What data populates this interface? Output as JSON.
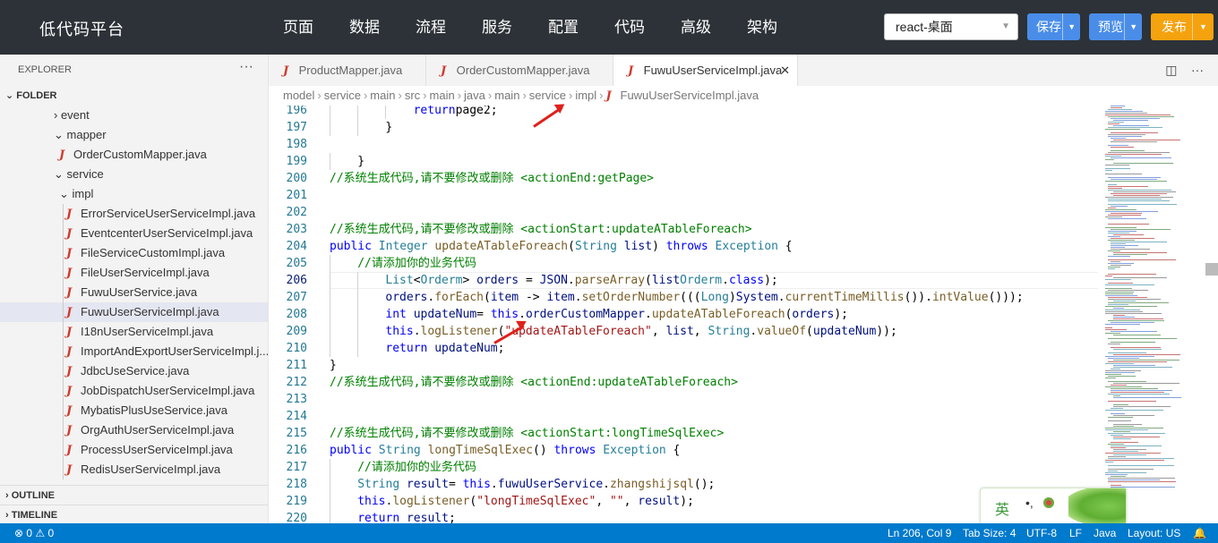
{
  "app": {
    "title": "低代码平台",
    "nav": [
      "页面",
      "数据",
      "流程",
      "服务",
      "配置",
      "代码",
      "高级",
      "架构"
    ],
    "env_select": "react-桌面",
    "buttons": {
      "save": "保存",
      "preview": "预览",
      "publish": "发布"
    },
    "colors": {
      "topbar": "#2d3238",
      "save": "#4a8de8",
      "publish": "#f5a20f",
      "status": "#007acc"
    }
  },
  "sidebar": {
    "title": "EXPLORER",
    "more": "···",
    "folder": "FOLDER",
    "items": [
      {
        "label": "event",
        "kind": "folder",
        "open": false,
        "indent": 1
      },
      {
        "label": "mapper",
        "kind": "folder",
        "open": true,
        "indent": 1
      },
      {
        "label": "OrderCustomMapper.java",
        "kind": "java",
        "indent": 2
      },
      {
        "label": "service",
        "kind": "folder",
        "open": true,
        "indent": 1
      },
      {
        "label": "impl",
        "kind": "folder",
        "open": true,
        "indent": 2
      },
      {
        "label": "ErrorServiceUserServiceImpl.java",
        "kind": "java",
        "indent": 3
      },
      {
        "label": "EventcenterUserServiceImpl.java",
        "kind": "java",
        "indent": 3
      },
      {
        "label": "FileServiceCustomImpl.java",
        "kind": "java",
        "indent": 3
      },
      {
        "label": "FileUserServiceImpl.java",
        "kind": "java",
        "indent": 3
      },
      {
        "label": "FuwuUserService.java",
        "kind": "java",
        "indent": 3
      },
      {
        "label": "FuwuUserServiceImpl.java",
        "kind": "java",
        "indent": 3,
        "selected": true
      },
      {
        "label": "I18nUserServiceImpl.java",
        "kind": "java",
        "indent": 3
      },
      {
        "label": "ImportAndExportUserServiceImpl.j...",
        "kind": "java",
        "indent": 3
      },
      {
        "label": "JdbcUseService.java",
        "kind": "java",
        "indent": 3
      },
      {
        "label": "JobDispatchUserServiceImpl.java",
        "kind": "java",
        "indent": 3
      },
      {
        "label": "MybatisPlusUseService.java",
        "kind": "java",
        "indent": 3
      },
      {
        "label": "OrgAuthUserServiceImpl.java",
        "kind": "java",
        "indent": 3
      },
      {
        "label": "ProcessUserServiceImpl.java",
        "kind": "java",
        "indent": 3
      },
      {
        "label": "RedisUserServiceImpl.java",
        "kind": "java",
        "indent": 3
      }
    ],
    "outline": "OUTLINE",
    "timeline": "TIMELINE"
  },
  "tabs": [
    {
      "label": "ProductMapper.java",
      "active": false
    },
    {
      "label": "OrderCustomMapper.java",
      "active": false
    },
    {
      "label": "FuwuUserServiceImpl.java",
      "active": true
    }
  ],
  "breadcrumb": [
    "model",
    "service",
    "main",
    "src",
    "main",
    "java",
    "main",
    "service",
    "impl",
    "FuwuUserServiceImpl.java"
  ],
  "editor": {
    "lines": [
      {
        "n": "196",
        "indent": 3,
        "tokens": [
          [
            "kw",
            "return"
          ],
          [
            "",
            "page2;"
          ]
        ]
      },
      {
        "n": "197",
        "indent": 2,
        "tokens": [
          [
            "",
            "}"
          ]
        ]
      },
      {
        "n": "198",
        "indent": 0,
        "tokens": []
      },
      {
        "n": "199",
        "indent": 1,
        "tokens": [
          [
            "",
            "}"
          ]
        ]
      },
      {
        "n": "200",
        "indent": 0,
        "tokens": [
          [
            "cm",
            "//系统生成代码,请不要修改或删除 <actionEnd:getPage>"
          ]
        ]
      },
      {
        "n": "201",
        "indent": 0,
        "tokens": []
      },
      {
        "n": "202",
        "indent": 0,
        "tokens": []
      },
      {
        "n": "203",
        "indent": 0,
        "tokens": [
          [
            "cm",
            "//系统生成代码,请不要修改或删除 <actionStart:updateATableForeach>"
          ]
        ]
      },
      {
        "n": "204",
        "indent": 0,
        "tokens": [
          [
            "kw",
            "public"
          ],
          [
            "",
            " "
          ],
          [
            "ty",
            "Integer"
          ],
          [
            "",
            " "
          ],
          [
            "fn",
            "updateATableForeach"
          ],
          [
            "",
            "("
          ],
          [
            "ty",
            "String"
          ],
          [
            "",
            " "
          ],
          [
            "vr",
            "list"
          ],
          [
            "",
            ") "
          ],
          [
            "kw",
            "throws"
          ],
          [
            "",
            " "
          ],
          [
            "ty",
            "Exception"
          ],
          [
            "",
            " {"
          ]
        ]
      },
      {
        "n": "205",
        "indent": 1,
        "tokens": [
          [
            "cm",
            "//请添加你的业务代码"
          ]
        ]
      },
      {
        "n": "206",
        "indent": 2,
        "current": true,
        "tokens": [
          [
            "ty",
            "List"
          ],
          [
            "",
            "<"
          ],
          [
            "ty",
            "Orderm"
          ],
          [
            "",
            "> "
          ],
          [
            "vr",
            "orders"
          ],
          [
            "",
            " = "
          ],
          [
            "vr",
            "JSON"
          ],
          [
            "",
            "."
          ],
          [
            "fn",
            "parseArray"
          ],
          [
            "",
            "("
          ],
          [
            "vr",
            "list"
          ],
          [
            ", "
          ],
          [
            "ty",
            "Orderm"
          ],
          [
            "",
            "."
          ],
          [
            "kw",
            "class"
          ],
          [
            "",
            ");"
          ]
        ]
      },
      {
        "n": "207",
        "indent": 2,
        "tokens": [
          [
            "vr",
            "orders"
          ],
          [
            "",
            "."
          ],
          [
            "fn",
            "forEach"
          ],
          [
            "",
            "("
          ],
          [
            "vr",
            "item"
          ],
          [
            "",
            " -> "
          ],
          [
            "vr",
            "item"
          ],
          [
            "",
            "."
          ],
          [
            "fn",
            "setOrderNumber"
          ],
          [
            "",
            "((("
          ],
          [
            "ty",
            "Long"
          ],
          [
            "",
            ")"
          ],
          [
            "vr",
            "System"
          ],
          [
            "",
            "."
          ],
          [
            "fn",
            "currentTimeMillis"
          ],
          [
            "",
            "())."
          ],
          [
            "fn",
            "intValue"
          ],
          [
            "",
            "()));"
          ]
        ]
      },
      {
        "n": "208",
        "indent": 2,
        "tokens": [
          [
            "kw",
            "int"
          ],
          [
            "",
            " "
          ],
          [
            "vr",
            "updateNum"
          ],
          [
            "",
            "= "
          ],
          [
            "kw",
            "this"
          ],
          [
            "",
            "."
          ],
          [
            "vr",
            "orderCustomMapper"
          ],
          [
            "",
            "."
          ],
          [
            "fn",
            "updateATableForeach"
          ],
          [
            "",
            "("
          ],
          [
            "vr",
            "orders"
          ],
          [
            "",
            ");"
          ]
        ]
      },
      {
        "n": "209",
        "indent": 2,
        "tokens": [
          [
            "kw",
            "this"
          ],
          [
            "",
            "."
          ],
          [
            "fn",
            "logListener"
          ],
          [
            "",
            "("
          ],
          [
            "st",
            "\"updateATableForeach\""
          ],
          [
            "",
            ", "
          ],
          [
            "vr",
            "list"
          ],
          [
            "",
            ", "
          ],
          [
            "ty",
            "String"
          ],
          [
            "",
            "."
          ],
          [
            "fn",
            "valueOf"
          ],
          [
            "",
            "("
          ],
          [
            "vr",
            "updateNum"
          ],
          [
            "",
            "));"
          ]
        ]
      },
      {
        "n": "210",
        "indent": 2,
        "tokens": [
          [
            "kw",
            "return"
          ],
          [
            "",
            " "
          ],
          [
            "vr",
            "updateNum"
          ],
          [
            "",
            ";"
          ]
        ]
      },
      {
        "n": "211",
        "indent": 0,
        "tokens": [
          [
            "",
            "}"
          ]
        ]
      },
      {
        "n": "212",
        "indent": 0,
        "tokens": [
          [
            "cm",
            "//系统生成代码,请不要修改或删除 <actionEnd:updateATableForeach>"
          ]
        ]
      },
      {
        "n": "213",
        "indent": 0,
        "tokens": []
      },
      {
        "n": "214",
        "indent": 0,
        "tokens": []
      },
      {
        "n": "215",
        "indent": 0,
        "tokens": [
          [
            "cm",
            "//系统生成代码,请不要修改或删除 <actionStart:longTimeSqlExec>"
          ]
        ]
      },
      {
        "n": "216",
        "indent": 0,
        "tokens": [
          [
            "kw",
            "public"
          ],
          [
            "",
            " "
          ],
          [
            "ty",
            "String"
          ],
          [
            "",
            " "
          ],
          [
            "fn",
            "longTimeSqlExec"
          ],
          [
            "",
            "() "
          ],
          [
            "kw",
            "throws"
          ],
          [
            "",
            " "
          ],
          [
            "ty",
            "Exception"
          ],
          [
            "",
            " {"
          ]
        ]
      },
      {
        "n": "217",
        "indent": 1,
        "tokens": [
          [
            "cm",
            "//请添加你的业务代码"
          ]
        ]
      },
      {
        "n": "218",
        "indent": 1,
        "tokens": [
          [
            "ty",
            "String"
          ],
          [
            "",
            " "
          ],
          [
            "vr",
            "result"
          ],
          [
            "",
            "= "
          ],
          [
            "kw",
            "this"
          ],
          [
            "",
            "."
          ],
          [
            "vr",
            "fuwuUserService"
          ],
          [
            "",
            "."
          ],
          [
            "fn",
            "zhangshijsql"
          ],
          [
            "",
            "();"
          ]
        ]
      },
      {
        "n": "219",
        "indent": 1,
        "tokens": [
          [
            "kw",
            "this"
          ],
          [
            "",
            "."
          ],
          [
            "fn",
            "logListener"
          ],
          [
            "",
            "("
          ],
          [
            "st",
            "\"longTimeSqlExec\""
          ],
          [
            "",
            ", "
          ],
          [
            "st",
            "\"\""
          ],
          [
            "",
            ", "
          ],
          [
            "vr",
            "result"
          ],
          [
            "",
            ");"
          ]
        ]
      },
      {
        "n": "220",
        "indent": 1,
        "tokens": [
          [
            "kw",
            "return"
          ],
          [
            "",
            " "
          ],
          [
            "vr",
            "result"
          ],
          [
            "",
            ";"
          ]
        ]
      }
    ]
  },
  "ime": {
    "label": "英",
    "dots": "•,"
  },
  "statusbar": {
    "problems": "⊗ 0  ⚠ 0",
    "position": "Ln 206, Col 9",
    "tabsize": "Tab Size: 4",
    "encoding": "UTF-8",
    "eol": "LF",
    "language": "Java",
    "layout": "Layout: US",
    "bell": "🔔"
  }
}
